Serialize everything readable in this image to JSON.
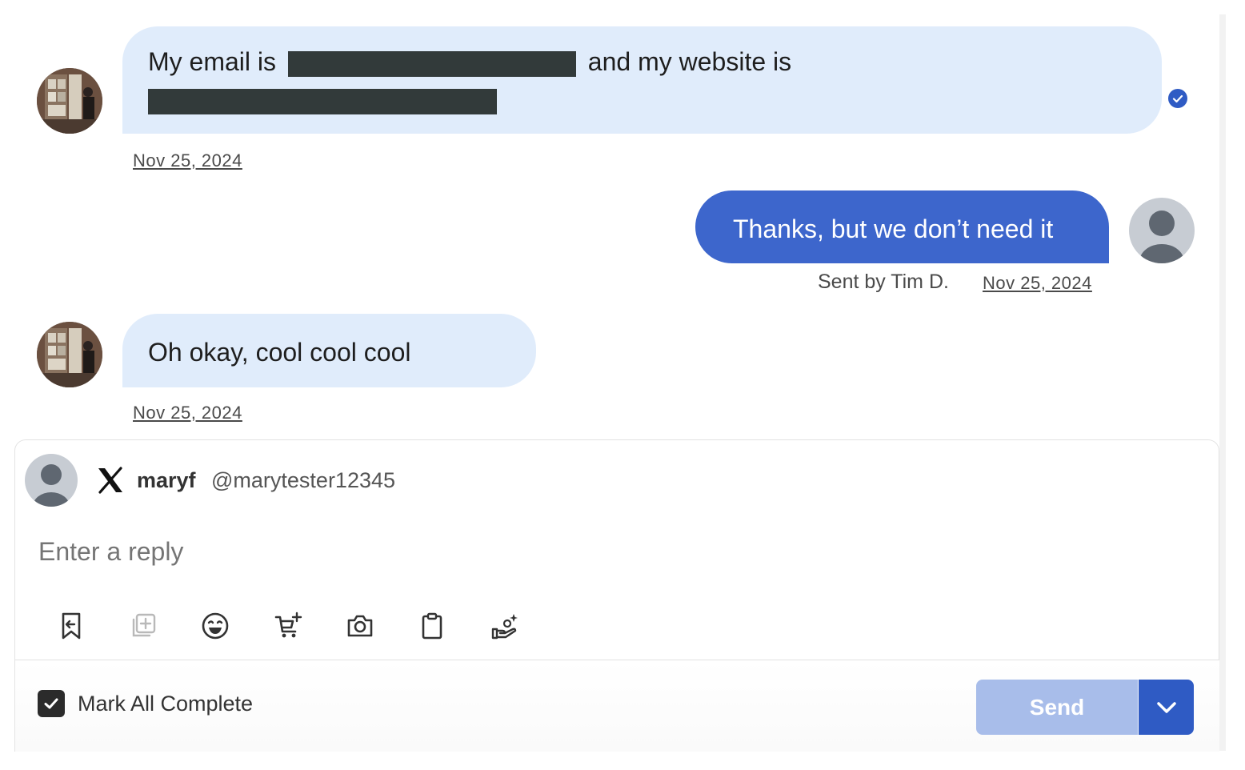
{
  "messages": [
    {
      "direction": "incoming",
      "text_before": "My email is",
      "text_middle": "and my website is",
      "date": "Nov 25, 2024"
    },
    {
      "direction": "outgoing",
      "text": "Thanks, but we don’t need it",
      "sent_by": "Sent by Tim D.",
      "date": "Nov 25, 2024"
    },
    {
      "direction": "incoming",
      "text": "Oh okay, cool cool cool",
      "date": "Nov 25, 2024"
    }
  ],
  "composer": {
    "display_name": "maryf",
    "handle": "@marytester12345",
    "channel_icon": "x-logo-icon",
    "placeholder": "Enter a reply",
    "tools": [
      "reply-bookmark-icon",
      "add-media-icon",
      "emoji-icon",
      "add-to-cart-icon",
      "camera-icon",
      "clipboard-icon",
      "offer-hand-icon"
    ]
  },
  "footer": {
    "mark_all_label": "Mark All Complete",
    "mark_all_checked": true,
    "send_label": "Send"
  },
  "colors": {
    "incoming_bubble": "#e0ecfb",
    "outgoing_bubble": "#3d66cc",
    "send_disabled": "#a8bdea",
    "send_dropdown": "#2f5bc4",
    "verified": "#2f5bc4"
  }
}
